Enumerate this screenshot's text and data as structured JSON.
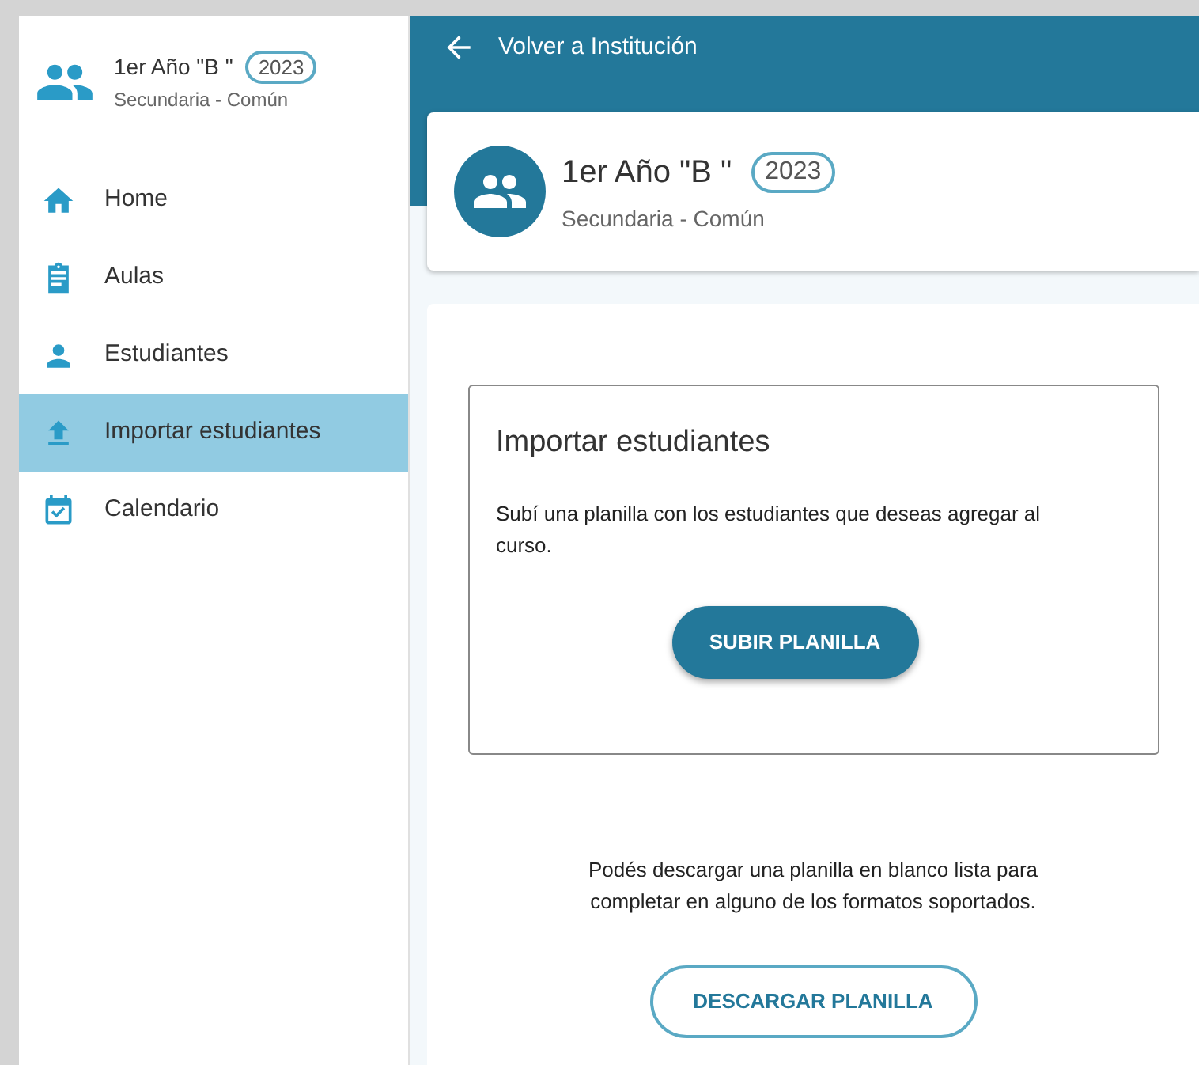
{
  "sidebar": {
    "course": {
      "title": "1er Año \"B \"",
      "year": "2023",
      "subtitle": "Secundaria - Común"
    },
    "items": [
      {
        "label": "Home",
        "selected": false
      },
      {
        "label": "Aulas",
        "selected": false
      },
      {
        "label": "Estudiantes",
        "selected": false
      },
      {
        "label": "Importar estudiantes",
        "selected": true
      },
      {
        "label": "Calendario",
        "selected": false
      }
    ]
  },
  "header": {
    "back_label": "Volver a Institución"
  },
  "course_card": {
    "title": "1er Año \"B \"",
    "year": "2023",
    "subtitle": "Secundaria - Común"
  },
  "import_box": {
    "title": "Importar estudiantes",
    "description": "Subí una planilla con los estudiantes que deseas agregar al curso.",
    "button": "SUBIR PLANILLA"
  },
  "download": {
    "text": "Podés descargar una planilla en blanco lista para completar en alguno de los formatos soportados.",
    "button": "DESCARGAR PLANILLA"
  }
}
